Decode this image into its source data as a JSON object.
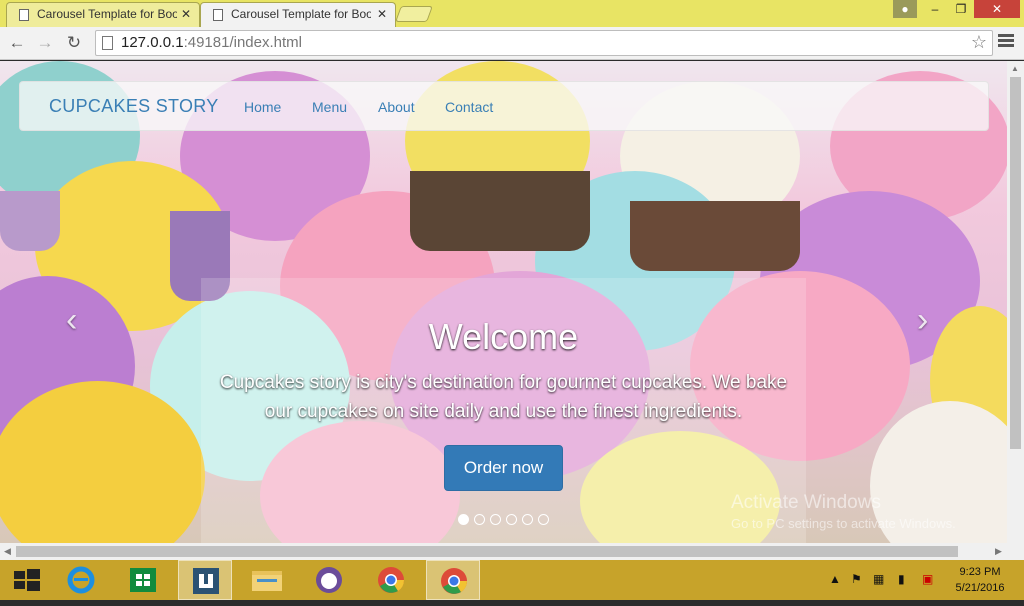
{
  "browser": {
    "tabs": [
      {
        "title": "Carousel Template for Boo",
        "close": "✕"
      },
      {
        "title": "Carousel Template for Boo",
        "close": "✕"
      }
    ],
    "url_host": "127.0.0.1",
    "url_rest": ":49181/index.html",
    "window_controls": {
      "minimize": "–",
      "maximize": "❐",
      "close": "✕"
    }
  },
  "site": {
    "brand": "CUPCAKES STORY",
    "nav": [
      "Home",
      "Menu",
      "About",
      "Contact"
    ],
    "carousel": {
      "title": "Welcome",
      "text": "Cupcakes story is city's destination for gourmet cupcakes. We bake our cupcakes on site daily and use the finest ingredients.",
      "button": "Order now",
      "slides": 6,
      "active_slide": 1,
      "prev": "‹",
      "next": "›"
    }
  },
  "watermark": {
    "line1": "Activate Windows",
    "line2": "Go to PC settings to activate Windows."
  },
  "taskbar": {
    "time": "9:23 PM",
    "date": "5/21/2016"
  },
  "colors": {
    "link": "#3a7fb5",
    "button": "#337ab7",
    "taskbar": "#c7a32a",
    "titlebar": "#e8e464"
  }
}
